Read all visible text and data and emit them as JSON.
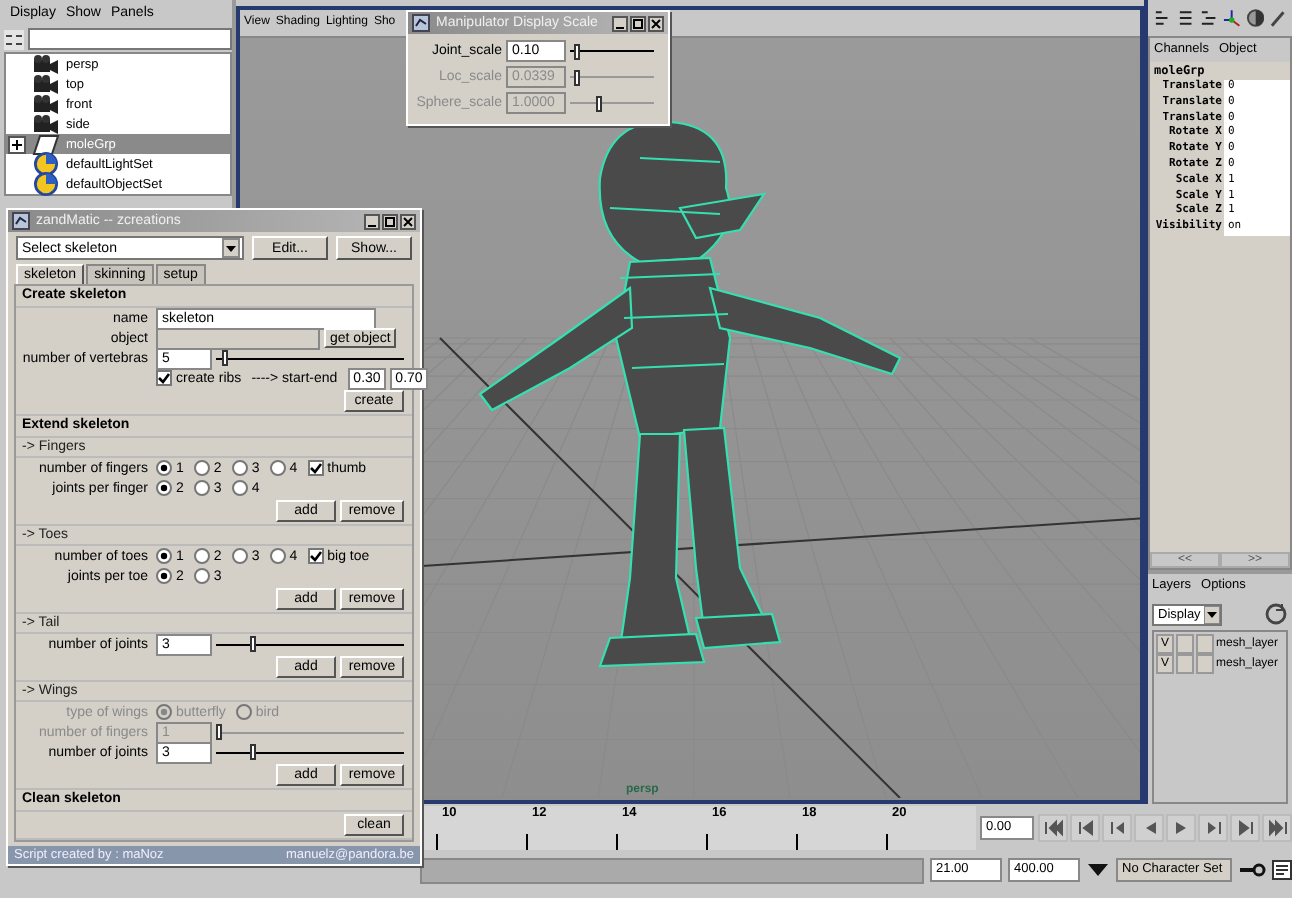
{
  "outliner": {
    "menu": [
      "Display",
      "Show",
      "Panels"
    ],
    "items": [
      {
        "label": "persp",
        "kind": "camera",
        "selected": false
      },
      {
        "label": "top",
        "kind": "camera",
        "selected": false
      },
      {
        "label": "front",
        "kind": "camera",
        "selected": false
      },
      {
        "label": "side",
        "kind": "camera",
        "selected": false
      },
      {
        "label": "moleGrp",
        "kind": "transform",
        "selected": true,
        "expanded": false
      },
      {
        "label": "defaultLightSet",
        "kind": "set",
        "selected": false
      },
      {
        "label": "defaultObjectSet",
        "kind": "set",
        "selected": false
      }
    ]
  },
  "viewport": {
    "menu": [
      "View",
      "Shading",
      "Lighting",
      "Sho"
    ],
    "camera_label": "persp"
  },
  "manipulator_window": {
    "title": "Manipulator Display Scale",
    "rows": [
      {
        "label": "Joint_scale",
        "value": "0.10",
        "level": 0.05,
        "disabled": false
      },
      {
        "label": "Loc_scale",
        "value": "0.0339",
        "level": 0.05,
        "disabled": true
      },
      {
        "label": "Sphere_scale",
        "value": "1.0000",
        "level": 0.3,
        "disabled": true
      }
    ]
  },
  "skeleton_window": {
    "title": "zandMatic -- zcreations",
    "selector": "Select skeleton",
    "buttons": [
      "Edit...",
      "Show..."
    ],
    "tabs": [
      {
        "label": "skeleton",
        "selected": true
      },
      {
        "label": "skinning",
        "selected": false
      },
      {
        "label": "setup",
        "selected": false
      }
    ],
    "sections": [
      {
        "title": "Create skeleton",
        "groups": [
          {
            "rows": [
              {
                "kind": "field",
                "label": "name",
                "value": "skeleton",
                "disabled": false
              },
              {
                "kind": "field_button",
                "label": "object",
                "button": "get object"
              },
              {
                "kind": "slider",
                "label": "number of vertebras",
                "value": "5",
                "level": 0.03,
                "disabled": false
              },
              {
                "kind": "check_range",
                "check_label": "create ribs",
                "checked": true,
                "range_label": "----> start-end",
                "values": [
                  "0.30",
                  "0.70"
                ]
              },
              {
                "kind": "buttons",
                "buttons": [
                  "create"
                ]
              }
            ]
          }
        ]
      },
      {
        "title": "Extend skeleton",
        "groups": [
          {
            "title": "-> Fingers",
            "rows": [
              {
                "kind": "radios",
                "label": "number of fingers",
                "disabled": false,
                "options": [
                  {
                    "label": "1",
                    "selected": true
                  },
                  {
                    "label": "2",
                    "selected": false
                  },
                  {
                    "label": "3",
                    "selected": false
                  },
                  {
                    "label": "4",
                    "selected": false
                  }
                ],
                "check": {
                  "label": "thumb",
                  "checked": true
                }
              },
              {
                "kind": "radios",
                "label": "joints per finger",
                "disabled": false,
                "options": [
                  {
                    "label": "2",
                    "selected": true
                  },
                  {
                    "label": "3",
                    "selected": false
                  },
                  {
                    "label": "4",
                    "selected": false
                  }
                ]
              },
              {
                "kind": "buttons",
                "buttons": [
                  "add",
                  "remove"
                ]
              }
            ]
          },
          {
            "title": "-> Toes",
            "rows": [
              {
                "kind": "radios",
                "label": "number of toes",
                "disabled": false,
                "options": [
                  {
                    "label": "1",
                    "selected": true
                  },
                  {
                    "label": "2",
                    "selected": false
                  },
                  {
                    "label": "3",
                    "selected": false
                  },
                  {
                    "label": "4",
                    "selected": false
                  }
                ],
                "check": {
                  "label": "big toe",
                  "checked": true
                }
              },
              {
                "kind": "radios",
                "label": "joints per toe",
                "disabled": false,
                "options": [
                  {
                    "label": "2",
                    "selected": true
                  },
                  {
                    "label": "3",
                    "selected": false
                  }
                ]
              },
              {
                "kind": "buttons",
                "buttons": [
                  "add",
                  "remove"
                ]
              }
            ]
          },
          {
            "title": "-> Tail",
            "rows": [
              {
                "kind": "slider",
                "label": "number of joints",
                "value": "3",
                "level": 0.18,
                "disabled": false
              },
              {
                "kind": "buttons",
                "buttons": [
                  "add",
                  "remove"
                ]
              }
            ]
          },
          {
            "title": "-> Wings",
            "rows": [
              {
                "kind": "radios",
                "label": "type of wings",
                "disabled": true,
                "options": [
                  {
                    "label": "butterfly",
                    "selected": true
                  },
                  {
                    "label": "bird",
                    "selected": false
                  }
                ]
              },
              {
                "kind": "slider",
                "label": "number of fingers",
                "value": "1",
                "level": 0.0,
                "disabled": true
              },
              {
                "kind": "slider",
                "label": "number of joints",
                "value": "3",
                "level": 0.18,
                "disabled": false
              },
              {
                "kind": "buttons",
                "buttons": [
                  "add",
                  "remove"
                ]
              }
            ]
          }
        ]
      },
      {
        "title": "Clean skeleton",
        "groups": [
          {
            "rows": [
              {
                "kind": "buttons",
                "buttons": [
                  "clean"
                ]
              }
            ]
          }
        ]
      }
    ],
    "footer_left": "Script created by : maNoz",
    "footer_right": "manuelz@pandora.be"
  },
  "channel_box": {
    "tabs": [
      "Channels",
      "Object"
    ],
    "node": "moleGrp",
    "channels": [
      {
        "name": "Translate",
        "value": "0"
      },
      {
        "name": "Translate",
        "value": "0"
      },
      {
        "name": "Translate",
        "value": "0"
      },
      {
        "name": "Rotate X",
        "value": "0"
      },
      {
        "name": "Rotate Y",
        "value": "0"
      },
      {
        "name": "Rotate Z",
        "value": "0"
      },
      {
        "name": "Scale X",
        "value": "1"
      },
      {
        "name": "Scale Y",
        "value": "1"
      },
      {
        "name": "Scale Z",
        "value": "1"
      },
      {
        "name": "Visibility",
        "value": "on"
      }
    ],
    "scroll_buttons": [
      "<<",
      ">>"
    ]
  },
  "layers": {
    "menu": [
      "Layers",
      "Options"
    ],
    "mode": "Display",
    "items": [
      {
        "label": "mesh_layer",
        "visible_mark": "V"
      },
      {
        "label": "mesh_layer",
        "visible_mark": "V"
      }
    ]
  },
  "timeline": {
    "ticks": [
      "10",
      "12",
      "14",
      "16",
      "18",
      "20"
    ],
    "current_time": "0.00",
    "range_start": "21.00",
    "range_end": "400.00",
    "character_set": "No Character Set"
  }
}
